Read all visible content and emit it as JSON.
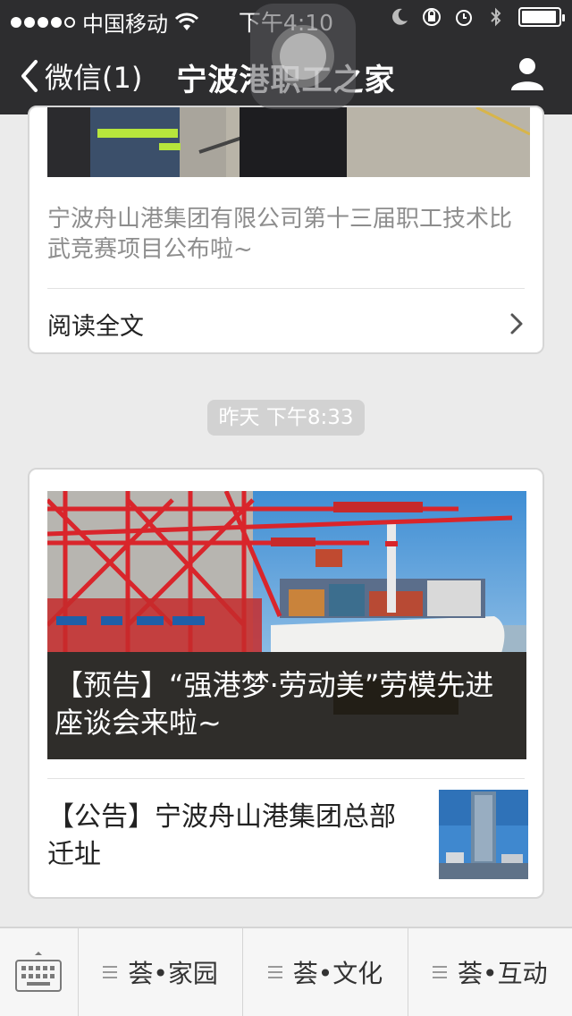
{
  "status_bar": {
    "carrier": "中国移动",
    "time": "下午4:10",
    "signal_strength": 4,
    "battery_level": 0.95,
    "icons": [
      "wifi-icon",
      "moon-icon",
      "rotation-lock-icon",
      "alarm-icon",
      "bluetooth-icon",
      "battery-icon"
    ]
  },
  "nav": {
    "back_label": "微信(1)",
    "title": "宁波港职工之家",
    "profile_icon": "person-icon"
  },
  "messages": {
    "card1": {
      "summary": "宁波舟山港集团有限公司第十三届职工技术比武竞赛项目公布啦~",
      "read_more": "阅读全文"
    },
    "timestamp": "昨天 下午8:33",
    "card2": {
      "hero_title": "【预告】“强港梦·劳动美”劳模先进座谈会来啦~",
      "item_title": "【公告】宁波舟山港集团总部迁址"
    }
  },
  "menu": {
    "keyboard_icon": "keyboard-icon",
    "items": [
      {
        "label": "荟•家园"
      },
      {
        "label": "荟•文化"
      },
      {
        "label": "荟•互动"
      }
    ]
  },
  "colors": {
    "bar_bg": "#2d2d2f",
    "chat_bg": "#ebebeb",
    "crane_red": "#d9252b"
  }
}
